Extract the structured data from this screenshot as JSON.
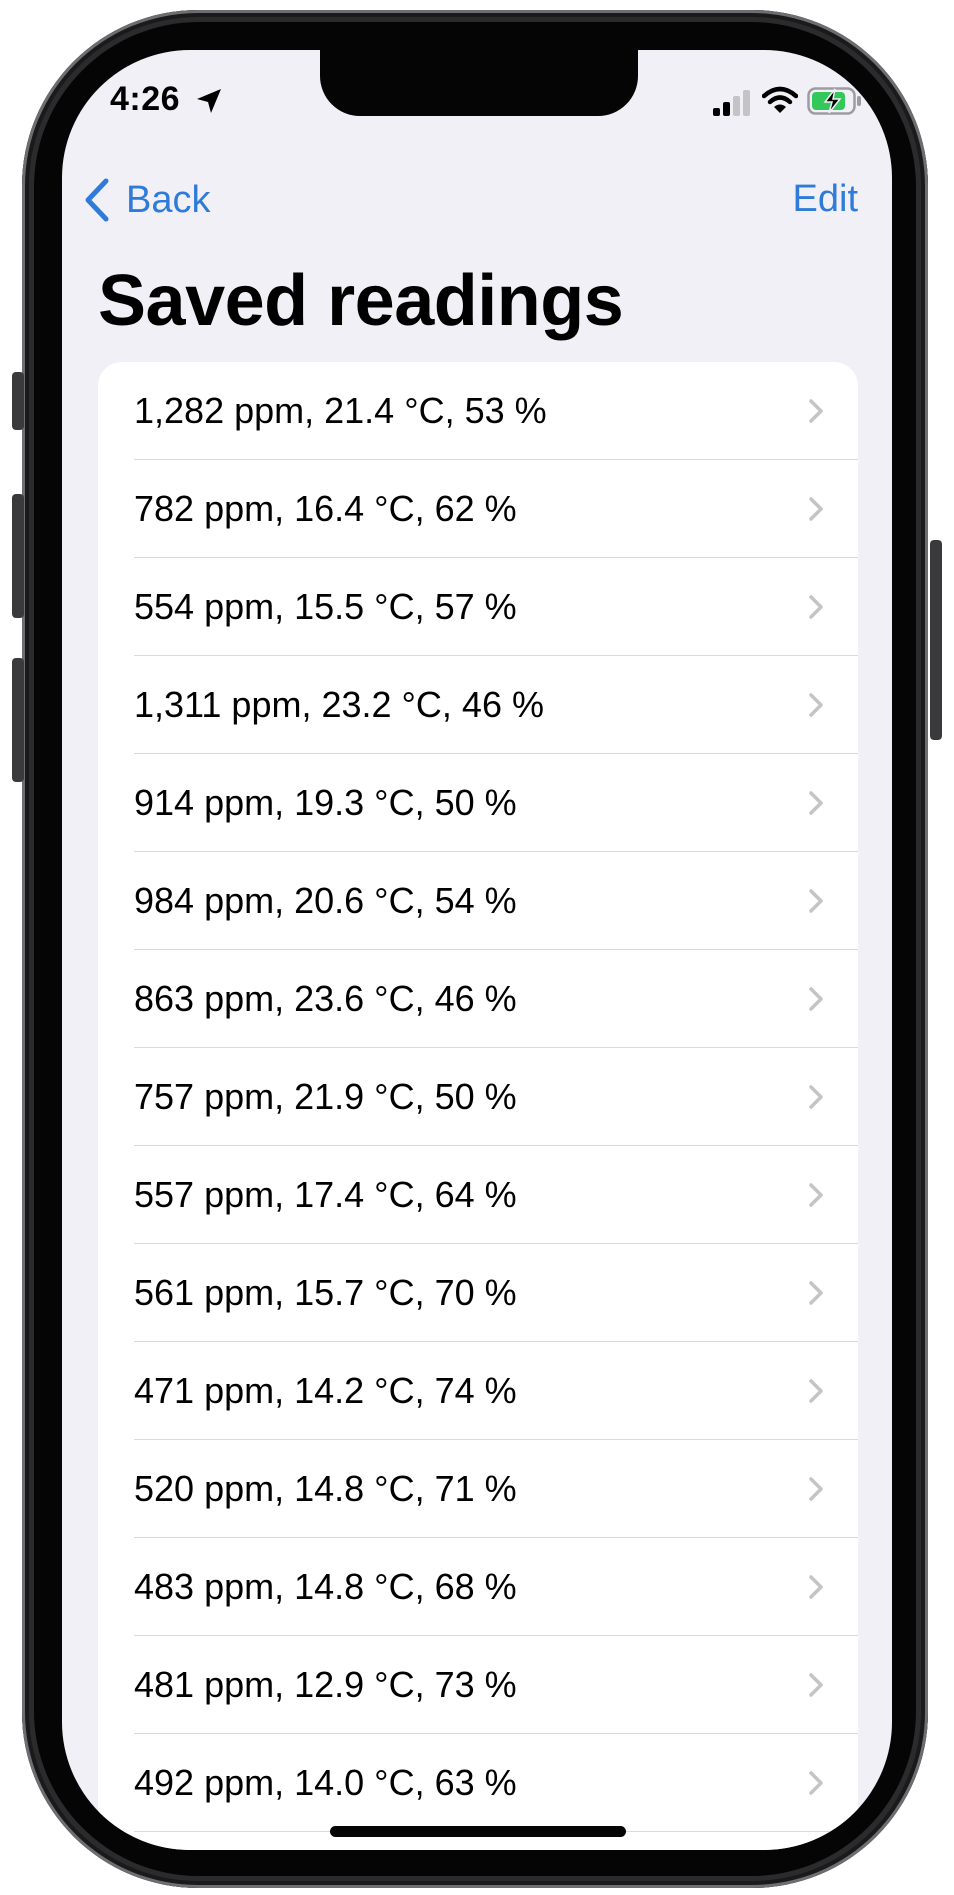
{
  "status_bar": {
    "time": "4:26",
    "icons": [
      "location-arrow-icon",
      "cellular-signal-icon",
      "wifi-icon",
      "battery-charging-icon"
    ]
  },
  "nav": {
    "back_label": "Back",
    "edit_label": "Edit",
    "accent_color": "#2f7bd9"
  },
  "title": "Saved readings",
  "readings": [
    "1,282 ppm, 21.4 °C, 53 %",
    "782 ppm, 16.4 °C, 62 %",
    "554 ppm, 15.5 °C, 57 %",
    "1,311 ppm, 23.2 °C, 46 %",
    "914 ppm, 19.3 °C, 50 %",
    "984 ppm, 20.6 °C, 54 %",
    "863 ppm, 23.6 °C, 46 %",
    "757 ppm, 21.9 °C, 50 %",
    "557 ppm, 17.4 °C, 64 %",
    "561 ppm, 15.7 °C, 70 %",
    "471 ppm, 14.2 °C, 74 %",
    "520 ppm, 14.8 °C, 71 %",
    "483 ppm, 14.8 °C, 68 %",
    "481 ppm, 12.9 °C, 73 %",
    "492 ppm, 14.0 °C, 63 %"
  ]
}
